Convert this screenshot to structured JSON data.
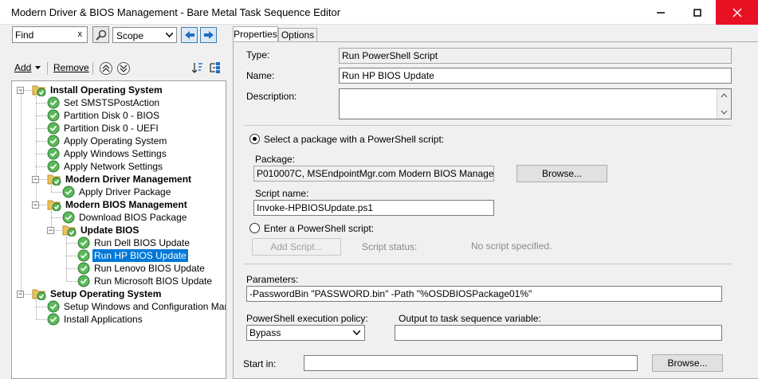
{
  "window": {
    "title": "Modern Driver & BIOS Management - Bare Metal Task Sequence Editor"
  },
  "toolbar": {
    "find_value": "Find",
    "find_clear": "x",
    "scope_value": "Scope",
    "add_label": "Add",
    "remove_label": "Remove"
  },
  "tree": [
    {
      "label": "Install Operating System",
      "type": "group",
      "level": 0
    },
    {
      "label": "Set SMSTSPostAction",
      "type": "step",
      "level": 1
    },
    {
      "label": "Partition Disk 0 - BIOS",
      "type": "step",
      "level": 1
    },
    {
      "label": "Partition Disk 0 - UEFI",
      "type": "step",
      "level": 1
    },
    {
      "label": "Apply Operating System",
      "type": "step",
      "level": 1
    },
    {
      "label": "Apply Windows Settings",
      "type": "step",
      "level": 1
    },
    {
      "label": "Apply Network Settings",
      "type": "step",
      "level": 1
    },
    {
      "label": "Modern Driver Management",
      "type": "group",
      "level": 1
    },
    {
      "label": "Apply Driver Package",
      "type": "step",
      "level": 2
    },
    {
      "label": "Modern BIOS Management",
      "type": "group",
      "level": 1
    },
    {
      "label": "Download BIOS Package",
      "type": "step",
      "level": 2
    },
    {
      "label": "Update BIOS",
      "type": "group",
      "level": 2
    },
    {
      "label": "Run Dell BIOS Update",
      "type": "step",
      "level": 3
    },
    {
      "label": "Run HP BIOS Update",
      "type": "step",
      "level": 3,
      "selected": true
    },
    {
      "label": "Run Lenovo BIOS Update",
      "type": "step",
      "level": 3
    },
    {
      "label": "Run Microsoft BIOS Update",
      "type": "step",
      "level": 3
    },
    {
      "label": "Setup Operating System",
      "type": "group",
      "level": 0
    },
    {
      "label": "Setup Windows and Configuration Manager",
      "type": "step",
      "level": 1
    },
    {
      "label": "Install Applications",
      "type": "step",
      "level": 1
    }
  ],
  "tabs": {
    "properties": "Properties",
    "options": "Options"
  },
  "properties": {
    "type_label": "Type:",
    "type_value": "Run PowerShell Script",
    "name_label": "Name:",
    "name_value": "Run HP BIOS Update",
    "description_label": "Description:",
    "description_value": "",
    "select_package_label": "Select a package with a PowerShell script:",
    "package_label": "Package:",
    "package_value": "P010007C, MSEndpointMgr.com Modern BIOS Management 2",
    "browse_label": "Browse...",
    "script_name_label": "Script name:",
    "script_name_value": "Invoke-HPBIOSUpdate.ps1",
    "enter_script_label": "Enter a PowerShell script:",
    "add_script_label": "Add Script...",
    "script_status_label": "Script status:",
    "script_status_value": "No script specified.",
    "parameters_label": "Parameters:",
    "parameters_value": "-PasswordBin \"PASSWORD.bin\" -Path \"%OSDBIOSPackage01%\"",
    "execution_policy_label": "PowerShell execution policy:",
    "execution_policy_value": "Bypass",
    "output_variable_label": "Output to task sequence variable:",
    "output_variable_value": "",
    "start_in_label": "Start in:",
    "start_in_value": "",
    "browse2_label": "Browse..."
  }
}
